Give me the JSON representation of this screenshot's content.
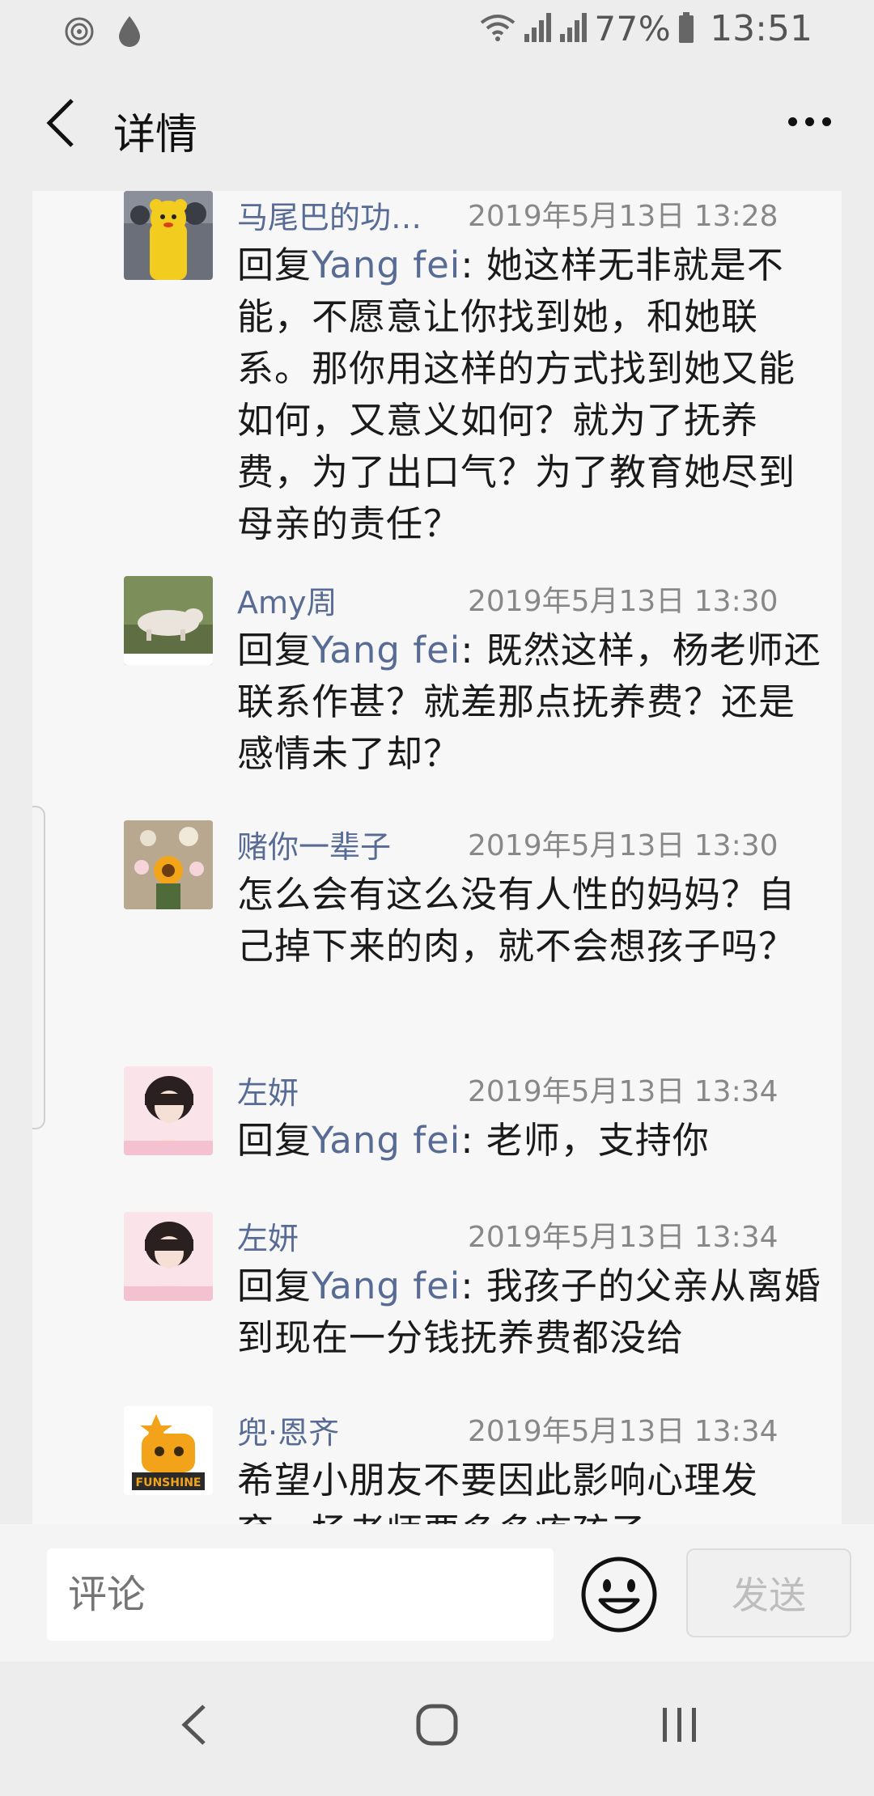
{
  "status_bar": {
    "battery": "77%",
    "time": "13:51"
  },
  "header": {
    "title": "详情"
  },
  "comments": [
    {
      "name": "马尾巴的功…",
      "time": "2019年5月13日 13:28",
      "prefix": "回复",
      "mention": "Yang fei",
      "text": ": 她这样无非就是不能，不愿意让你找到她，和她联系。那你用这样的方式找到她又能如何，又意义如何？就为了抚养费，为了出口气？为了教育她尽到母亲的责任？"
    },
    {
      "name": "Amy周",
      "time": "2019年5月13日 13:30",
      "prefix": "回复",
      "mention": "Yang fei",
      "text": ": 既然这样，杨老师还联系作甚？就差那点抚养费？还是感情未了却？"
    },
    {
      "name": "赌你一辈子",
      "time": "2019年5月13日 13:30",
      "prefix": "",
      "mention": "",
      "text": "怎么会有这么没有人性的妈妈？自己掉下来的肉，就不会想孩子吗？"
    },
    {
      "name": "左妍",
      "time": "2019年5月13日 13:34",
      "prefix": "回复",
      "mention": "Yang fei",
      "text": ": 老师，支持你"
    },
    {
      "name": "左妍",
      "time": "2019年5月13日 13:34",
      "prefix": "回复",
      "mention": "Yang fei",
      "text": ": 我孩子的父亲从离婚到现在一分钱抚养费都没给"
    },
    {
      "name": "兜·恩齐",
      "time": "2019年5月13日 13:34",
      "prefix": "",
      "mention": "",
      "text": "希望小朋友不要因此影响心理发育，杨老师要多多疼孩子",
      "avatar_text": "FUNSHINE"
    }
  ],
  "input": {
    "placeholder": "评论",
    "send_label": "发送"
  },
  "icons": {
    "status_left": [
      "nfc-icon",
      "drop-icon"
    ],
    "status_right": [
      "wifi-icon",
      "signal-icon",
      "signal-icon",
      "battery-icon"
    ],
    "header": [
      "back-arrow-icon",
      "more-icon"
    ],
    "input": [
      "emoji-icon"
    ],
    "nav": [
      "nav-back-icon",
      "nav-home-icon",
      "nav-recents-icon"
    ]
  },
  "colors": {
    "link": "#576b95",
    "background": "#ededed",
    "content_bg": "#f7f7f7"
  }
}
